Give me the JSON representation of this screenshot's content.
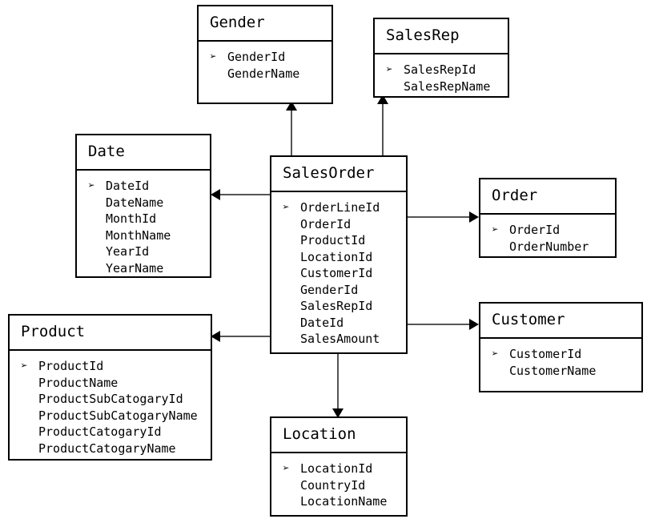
{
  "diagram": {
    "type": "star-schema-erd",
    "fact_table": "SalesOrder",
    "pk_marker": "➢",
    "colors": {
      "box_border": "#000000",
      "connector": "#555555",
      "arrow": "#000000",
      "background": "#ffffff",
      "text": "#000000"
    }
  },
  "entities": {
    "gender": {
      "name": "Gender",
      "fields": [
        {
          "label": "GenderId",
          "key": true
        },
        {
          "label": "GenderName",
          "key": false
        }
      ]
    },
    "salesrep": {
      "name": "SalesRep",
      "fields": [
        {
          "label": "SalesRepId",
          "key": true
        },
        {
          "label": "SalesRepName",
          "key": false
        }
      ]
    },
    "date": {
      "name": "Date",
      "fields": [
        {
          "label": "DateId",
          "key": true
        },
        {
          "label": "DateName",
          "key": false
        },
        {
          "label": "MonthId",
          "key": false
        },
        {
          "label": "MonthName",
          "key": false
        },
        {
          "label": "YearId",
          "key": false
        },
        {
          "label": "YearName",
          "key": false
        }
      ]
    },
    "salesorder": {
      "name": "SalesOrder",
      "fields": [
        {
          "label": "OrderLineId",
          "key": true
        },
        {
          "label": "OrderId",
          "key": false
        },
        {
          "label": "ProductId",
          "key": false
        },
        {
          "label": "LocationId",
          "key": false
        },
        {
          "label": "CustomerId",
          "key": false
        },
        {
          "label": "GenderId",
          "key": false
        },
        {
          "label": "SalesRepId",
          "key": false
        },
        {
          "label": "DateId",
          "key": false
        },
        {
          "label": "SalesAmount",
          "key": false
        }
      ]
    },
    "order": {
      "name": "Order",
      "fields": [
        {
          "label": "OrderId",
          "key": true
        },
        {
          "label": "OrderNumber",
          "key": false
        }
      ]
    },
    "customer": {
      "name": "Customer",
      "fields": [
        {
          "label": "CustomerId",
          "key": true
        },
        {
          "label": "CustomerName",
          "key": false
        }
      ]
    },
    "product": {
      "name": "Product",
      "fields": [
        {
          "label": "ProductId",
          "key": true
        },
        {
          "label": "ProductName",
          "key": false
        },
        {
          "label": "ProductSubCatogaryId",
          "key": false
        },
        {
          "label": "ProductSubCatogaryName",
          "key": false
        },
        {
          "label": "ProductCatogaryId",
          "key": false
        },
        {
          "label": "ProductCatogaryName",
          "key": false
        }
      ]
    },
    "location": {
      "name": "Location",
      "fields": [
        {
          "label": "LocationId",
          "key": true
        },
        {
          "label": "CountryId",
          "key": false
        },
        {
          "label": "LocationName",
          "key": false
        }
      ]
    }
  },
  "relationships": [
    {
      "from": "SalesOrder",
      "to": "Gender",
      "direction": "up"
    },
    {
      "from": "SalesOrder",
      "to": "SalesRep",
      "direction": "up"
    },
    {
      "from": "SalesOrder",
      "to": "Date",
      "direction": "left"
    },
    {
      "from": "SalesOrder",
      "to": "Order",
      "direction": "right"
    },
    {
      "from": "SalesOrder",
      "to": "Customer",
      "direction": "right"
    },
    {
      "from": "SalesOrder",
      "to": "Product",
      "direction": "left"
    },
    {
      "from": "SalesOrder",
      "to": "Location",
      "direction": "down"
    }
  ]
}
